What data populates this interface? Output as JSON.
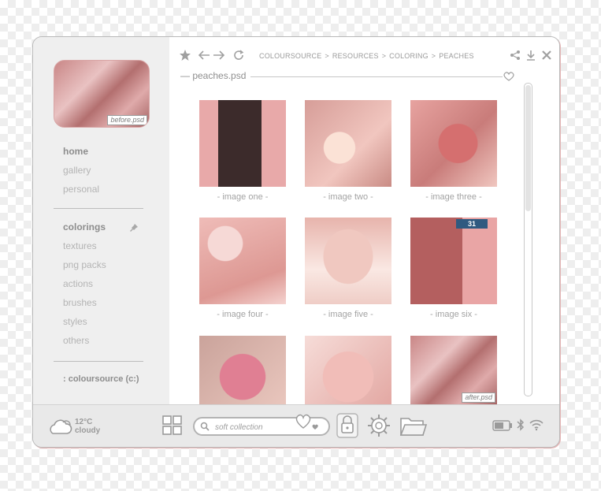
{
  "sidebar": {
    "thumbnail_label": "before.psd",
    "nav_primary": [
      {
        "label": "home",
        "active": true
      },
      {
        "label": "gallery",
        "active": false
      },
      {
        "label": "personal",
        "active": false
      }
    ],
    "nav_secondary": [
      {
        "label": "colorings",
        "active": true
      },
      {
        "label": "textures",
        "active": false
      },
      {
        "label": "png packs",
        "active": false
      },
      {
        "label": "actions",
        "active": false
      },
      {
        "label": "brushes",
        "active": false
      },
      {
        "label": "styles",
        "active": false
      },
      {
        "label": "others",
        "active": false
      }
    ],
    "footer_link": ": coloursource (c:)"
  },
  "toolbar": {
    "breadcrumb": [
      "COLOURSOURCE",
      ">",
      "RESOURCES",
      ">",
      "COLORING",
      ">",
      "PEACHES"
    ],
    "file_title": "— peaches.psd"
  },
  "gallery": {
    "items": [
      {
        "caption": "- image one -"
      },
      {
        "caption": "- image two -"
      },
      {
        "caption": "- image three -"
      },
      {
        "caption": "- image four -"
      },
      {
        "caption": "- image five -"
      },
      {
        "caption": "- image six -"
      },
      {
        "caption": ""
      },
      {
        "caption": ""
      },
      {
        "caption": "",
        "tag": "after.psd"
      }
    ],
    "sign_text": "31"
  },
  "taskbar": {
    "weather_temp": "12°C",
    "weather_desc": "cloudy",
    "search_placeholder": "soft collection"
  },
  "colors": {
    "accent": "#e8a9a9",
    "text_muted": "#a3a3a3",
    "border": "#b9b9b9"
  },
  "icons": [
    "star-icon",
    "back-arrow-icon",
    "forward-arrow-icon",
    "refresh-icon",
    "share-icon",
    "download-icon",
    "close-icon",
    "heart-icon",
    "pin-icon",
    "cloud-icon",
    "grid-icon",
    "search-icon",
    "lock-icon",
    "gear-icon",
    "folder-icon",
    "battery-icon",
    "bluetooth-icon",
    "wifi-icon"
  ]
}
